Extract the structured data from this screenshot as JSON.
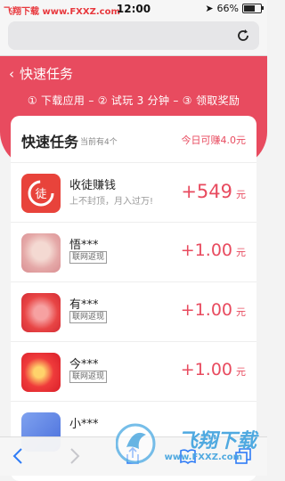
{
  "status": {
    "carrier": "飞翔下载 www.FXXZ.com",
    "time": "12:00",
    "battery": "66%",
    "battery_level": 0.66
  },
  "page": {
    "back_label": "快速任务",
    "steps": "① 下载应用  –  ② 试玩 3 分钟  –  ③ 领取奖励"
  },
  "card": {
    "title": "快速任务",
    "subtitle": "当前有4个",
    "today": "今日可赚4.0元"
  },
  "rows": [
    {
      "name": "收徒赚钱",
      "desc": "上不封顶，月入过万!",
      "reward": "+549",
      "unit": "元",
      "avatar_color": "#e8433b"
    },
    {
      "name": "悟***",
      "tag": "联网返现",
      "reward": "+1.00",
      "unit": "元",
      "avatar_color": "#e9b8b5"
    },
    {
      "name": "有***",
      "tag": "联网返现",
      "reward": "+1.00",
      "unit": "元",
      "avatar_color": "#e84545"
    },
    {
      "name": "今***",
      "tag": "联网返现",
      "reward": "+1.00",
      "unit": "元",
      "avatar_color": "#ef3b3b"
    },
    {
      "name": "小***",
      "reward": "",
      "unit": "",
      "avatar_color": "#5a7fe0"
    }
  ],
  "watermark": {
    "title": "飞翔下载",
    "url": "www.FXXZ.com"
  },
  "colors": {
    "accent": "#e84b5f"
  }
}
